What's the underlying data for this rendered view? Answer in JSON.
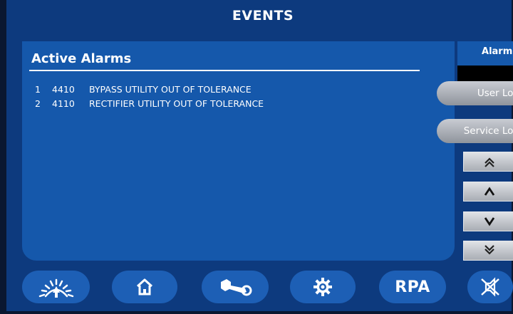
{
  "screen": {
    "title": "EVENTS"
  },
  "panel": {
    "heading": "Active Alarms",
    "alarms": [
      {
        "index": "1",
        "code": "4410",
        "description": "BYPASS UTILITY OUT OF TOLERANCE"
      },
      {
        "index": "2",
        "code": "4110",
        "description": "RECTIFIER UTILITY OUT OF TOLERANCE"
      }
    ]
  },
  "side_tabs": {
    "active": "Alarms",
    "user_log": "User Log",
    "service_log": "Service Log"
  },
  "scroll": {
    "icons": [
      "double-chevron-up-icon",
      "chevron-up-icon",
      "chevron-down-icon",
      "double-chevron-down-icon"
    ]
  },
  "nav": {
    "items": [
      "gauge-icon",
      "home-icon",
      "wrench-icon",
      "gear-icon",
      "RPA",
      "mute-alarm-icon"
    ],
    "rpa_label": "RPA"
  },
  "colors": {
    "background": "#0d3a7e",
    "panel": "#1558ab",
    "text": "#ffffff",
    "tab_gray": "#b0b4bb"
  }
}
